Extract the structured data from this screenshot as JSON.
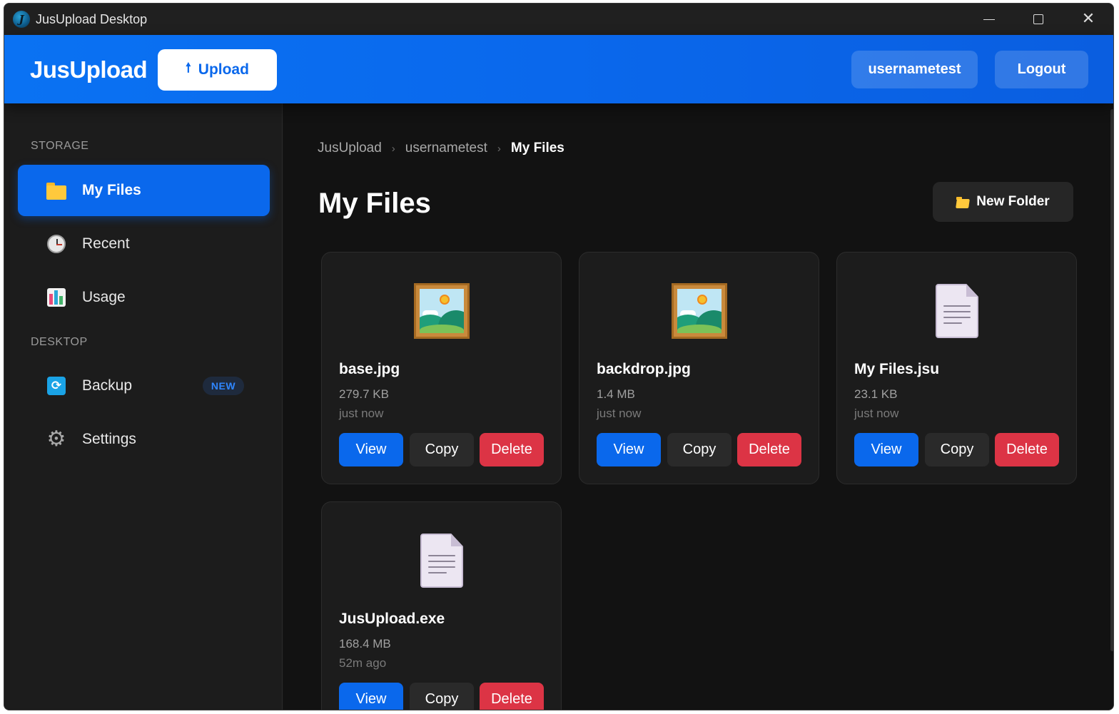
{
  "window": {
    "title": "JusUpload Desktop",
    "controls": {
      "minimize": "minimize-icon",
      "maximize": "maximize-icon",
      "close": "close-icon"
    }
  },
  "header": {
    "brand": "JusUpload",
    "upload_label": "Upload",
    "upload_icon": "upload-arrow-icon",
    "username": "usernametest",
    "logout_label": "Logout",
    "accent_color": "#0a68ec"
  },
  "sidebar": {
    "sections": [
      {
        "label": "STORAGE",
        "items": [
          {
            "label": "My Files",
            "icon": "folder-icon",
            "active": true
          },
          {
            "label": "Recent",
            "icon": "clock-icon",
            "active": false
          },
          {
            "label": "Usage",
            "icon": "chart-icon",
            "active": false
          }
        ]
      },
      {
        "label": "DESKTOP",
        "items": [
          {
            "label": "Backup",
            "icon": "backup-icon",
            "active": false,
            "badge": "NEW"
          },
          {
            "label": "Settings",
            "icon": "gear-icon",
            "active": false
          }
        ]
      }
    ]
  },
  "main": {
    "breadcrumb": [
      "JusUpload",
      "usernametest",
      "My Files"
    ],
    "title": "My Files",
    "new_folder_label": "New Folder",
    "files": [
      {
        "name": "base.jpg",
        "size": "279.7 KB",
        "time": "just now",
        "icon": "image-icon"
      },
      {
        "name": "backdrop.jpg",
        "size": "1.4 MB",
        "time": "just now",
        "icon": "image-icon"
      },
      {
        "name": "My Files.jsu",
        "size": "23.1 KB",
        "time": "just now",
        "icon": "document-icon"
      },
      {
        "name": "JusUpload.exe",
        "size": "168.4 MB",
        "time": "52m ago",
        "icon": "document-icon"
      }
    ],
    "actions": {
      "view": "View",
      "copy": "Copy",
      "delete": "Delete"
    },
    "colors": {
      "view": "#0a68ec",
      "copy": "#2a2a2a",
      "delete": "#dc3445"
    }
  }
}
